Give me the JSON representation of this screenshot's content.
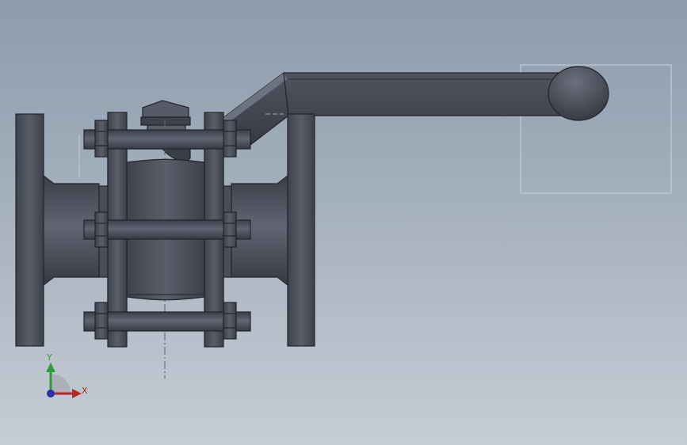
{
  "viewport": {
    "background_top": "#8d9bab",
    "background_bottom": "#c5ccd5"
  },
  "model": {
    "parts": [
      "left-end-flange",
      "body-flange-left",
      "valve-body",
      "body-flange-right",
      "right-end-flange",
      "stem-packing",
      "handle-lever",
      "handle-grip",
      "tie-bolts",
      "hex-nuts"
    ],
    "face_color": "#464a55",
    "edge_color": "#22252c"
  },
  "selection_box": {
    "visible": true,
    "color": "#d4dbe4"
  },
  "triad": {
    "x_label": "X",
    "y_label": "Y",
    "x_color": "#b4282a",
    "y_color": "#2e9a3a",
    "z_color": "#2b2fa8"
  }
}
